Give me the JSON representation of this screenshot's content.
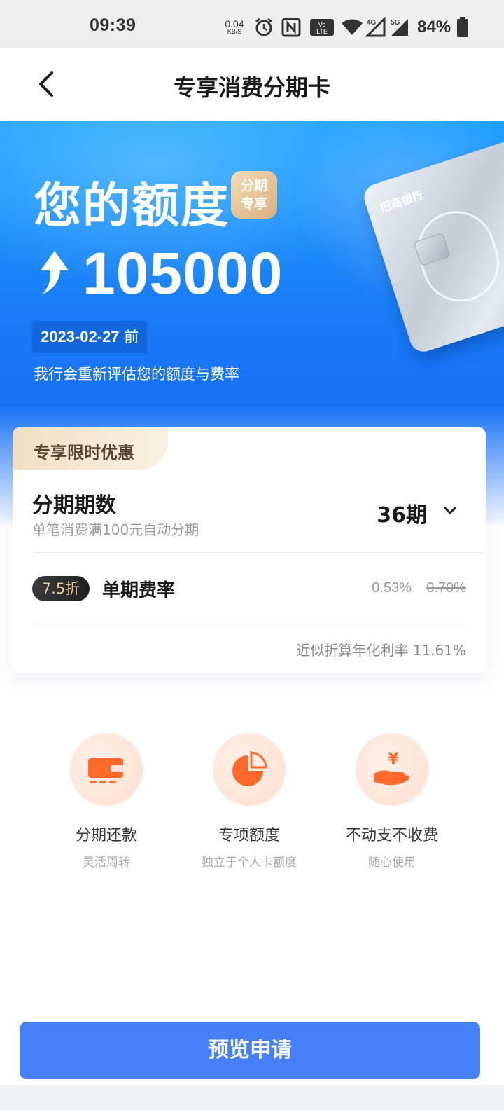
{
  "status_bar": {
    "time": "09:39",
    "net_speed_value": "0.04",
    "net_speed_unit": "KB/S",
    "battery": "84%",
    "icons": [
      "alarm-icon",
      "nfc-icon",
      "volte-icon",
      "wifi-icon",
      "signal-4g-icon",
      "signal-5g-icon",
      "battery-icon"
    ]
  },
  "nav": {
    "title": "专享消费分期卡"
  },
  "hero": {
    "title": "您的额度",
    "badge_line1": "分期",
    "badge_line2": "专享",
    "amount": "105000",
    "date": "2023-02-27",
    "date_suffix": " 前",
    "note": "我行会重新评估您的额度与费率",
    "card_logo": "招商银行"
  },
  "offer": {
    "tag": "专享限时优惠",
    "term_label": "分期期数",
    "term_sub": "单笔消费满100元自动分期",
    "term_value": "36期",
    "discount_badge": "7.5折",
    "rate_label": "单期费率",
    "rate_new": "0.53%",
    "rate_old": "0.70%",
    "apr_note": "近似折算年化利率 11.61%"
  },
  "features": [
    {
      "title": "分期还款",
      "sub": "灵活周转"
    },
    {
      "title": "专项额度",
      "sub": "独立于个人卡额度"
    },
    {
      "title": "不动支不收费",
      "sub": "随心使用"
    }
  ],
  "colors": {
    "primary_button": "#4680f8",
    "hero_blue": "#1a7ef7",
    "accent_orange": "#ff6a2a"
  },
  "actions": {
    "apply_label": "预览申请"
  }
}
